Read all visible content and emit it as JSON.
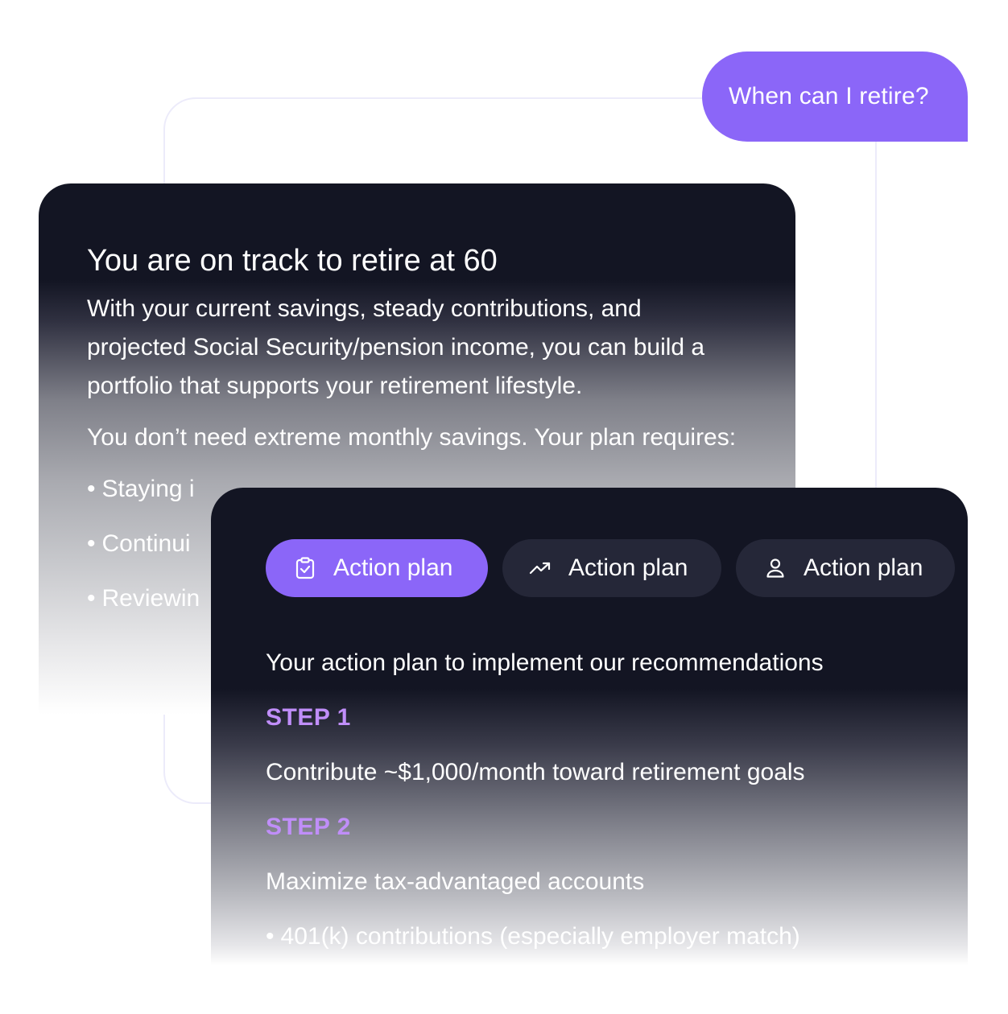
{
  "chat": {
    "user_message": "When can I retire?"
  },
  "answer": {
    "title": "You are on track to retire at 60",
    "paragraph_1": "With your current savings, steady contributions, and projected Social Security/pension income, you can build a portfolio that supports your retirement lifestyle.",
    "paragraph_2": "You don’t need extreme monthly savings. Your plan requires:",
    "requirements": [
      "Staying i",
      "Continui",
      "Reviewin"
    ]
  },
  "plan": {
    "tabs": [
      {
        "label": "Action plan",
        "icon": "clipboard-check-icon",
        "active": true
      },
      {
        "label": "Action plan",
        "icon": "trending-up-icon",
        "active": false
      },
      {
        "label": "Action plan",
        "icon": "user-icon",
        "active": false
      }
    ],
    "heading": "Your action plan to implement our recommendations",
    "steps": [
      {
        "label": "STEP 1",
        "text": "Contribute ~$1,000/month toward retirement goals"
      },
      {
        "label": "STEP 2",
        "text": "Maximize tax-advantaged accounts",
        "bullet": "401(k) contributions (especially employer match)"
      }
    ]
  },
  "colors": {
    "accent": "#8b66f8",
    "card_dark": "#131523",
    "tab_inactive": "#252738",
    "step_label": "#c08ef9",
    "outline": "#ecebfa"
  }
}
